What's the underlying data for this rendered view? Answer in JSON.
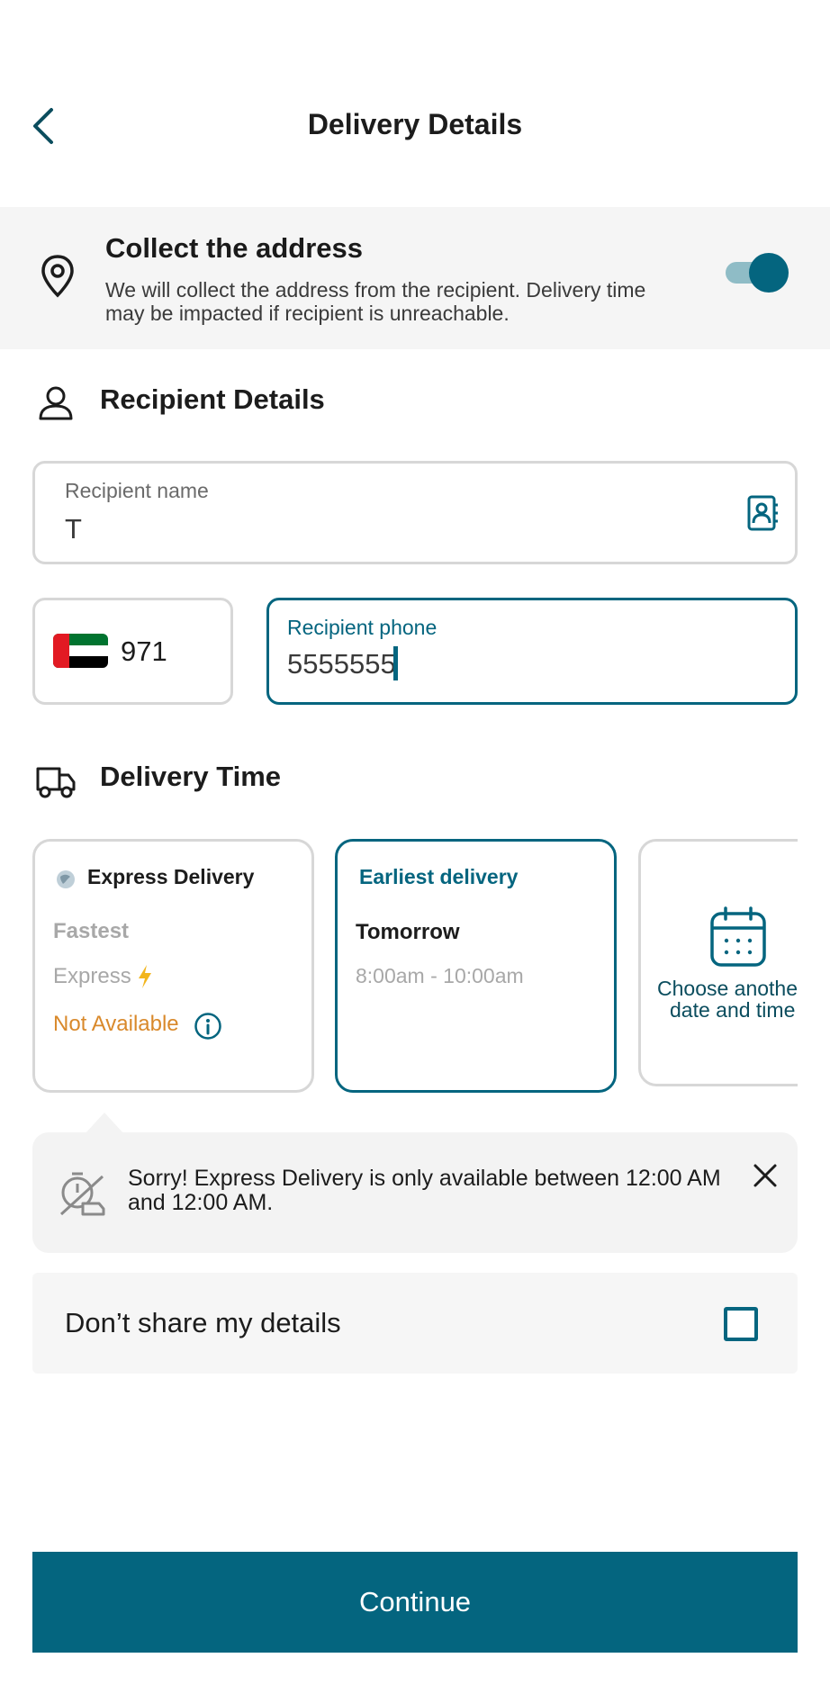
{
  "header": {
    "title": "Delivery Details"
  },
  "collect_address": {
    "title": "Collect the address",
    "description": "We will collect the address from the recipient. Delivery time may be impacted if recipient is unreachable.",
    "toggle_on": true
  },
  "recipient": {
    "section_title": "Recipient Details",
    "name_label": "Recipient name",
    "name_value": "T",
    "country_code": "971",
    "phone_label": "Recipient phone",
    "phone_value": "5555555"
  },
  "delivery_time": {
    "section_title": "Delivery Time",
    "express": {
      "title": "Express Delivery",
      "subtitle": "Fastest",
      "type": "Express",
      "status": "Not Available"
    },
    "earliest": {
      "title": "Earliest delivery",
      "day": "Tomorrow",
      "window": "8:00am - 10:00am"
    },
    "other": {
      "line1": "Choose another",
      "line2": "date and time"
    }
  },
  "notice": {
    "text": "Sorry! Express Delivery is only available between 12:00 AM and 12:00 AM."
  },
  "privacy": {
    "label": "Don’t share my details",
    "checked": false
  },
  "footer": {
    "continue_label": "Continue"
  },
  "colors": {
    "accent": "#04657f",
    "warning": "#d9892b",
    "bolt": "#f2b51c",
    "muted": "#a8a8a8"
  }
}
